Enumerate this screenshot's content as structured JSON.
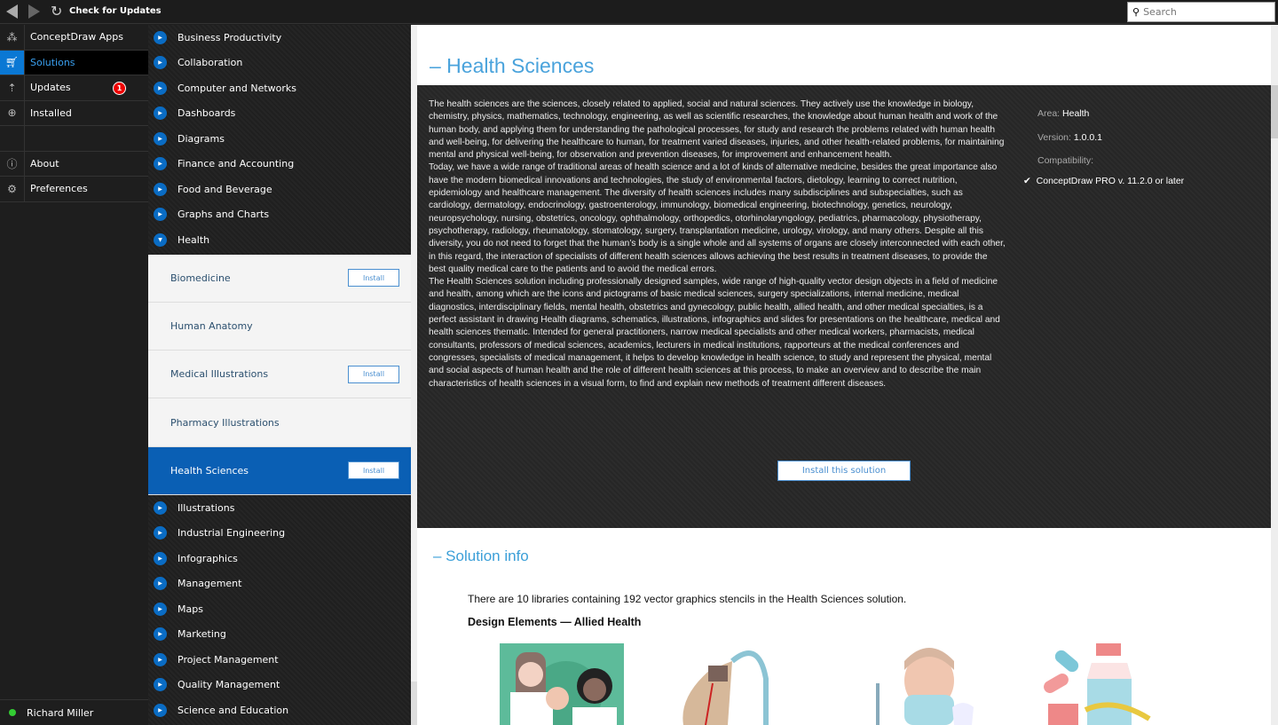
{
  "toolbar": {
    "check_updates": "Check for Updates",
    "search_placeholder": "Search"
  },
  "left_nav": {
    "items": [
      {
        "label": "ConceptDraw Apps",
        "icon": "apps-icon"
      },
      {
        "label": "Solutions",
        "icon": "cart-icon",
        "selected": true
      },
      {
        "label": "Updates",
        "icon": "updates-icon",
        "badge": "1"
      },
      {
        "label": "Installed",
        "icon": "download-icon"
      },
      {
        "label": "",
        "icon": ""
      },
      {
        "label": "About",
        "icon": "info-icon"
      },
      {
        "label": "Preferences",
        "icon": "gear-icon"
      }
    ],
    "user": "Richard Miller"
  },
  "categories_top": [
    "Business Productivity",
    "Collaboration",
    "Computer and Networks",
    "Dashboards",
    "Diagrams",
    "Finance and Accounting",
    "Food and Beverage",
    "Graphs and Charts",
    "Health"
  ],
  "health_solutions": [
    {
      "name": "Biomedicine",
      "button": "Install"
    },
    {
      "name": "Human Anatomy",
      "button": ""
    },
    {
      "name": "Medical Illustrations",
      "button": "Install"
    },
    {
      "name": "Pharmacy Illustrations",
      "button": ""
    },
    {
      "name": "Health Sciences",
      "button": "Install",
      "selected": true
    }
  ],
  "categories_bottom": [
    "Illustrations",
    "Industrial Engineering",
    "Infographics",
    "Management",
    "Maps",
    "Marketing",
    "Project Management",
    "Quality Management",
    "Science and Education"
  ],
  "main": {
    "title": "– Health Sciences",
    "description": [
      "The health sciences are the sciences, closely related to applied, social and natural sciences. They actively use the knowledge in biology, chemistry, physics, mathematics, technology, engineering, as well as scientific researches, the knowledge about human health and work of the human body, and applying them for understanding the pathological processes, for study and research the problems related with human health and well-being, for delivering the healthcare to human, for treatment varied diseases, injuries, and other health-related problems, for maintaining mental and physical well-being, for observation and prevention diseases, for improvement and enhancement health.",
      "Today, we have a wide range of traditional areas of health science and a lot of kinds of alternative medicine, besides the great importance also have the modern biomedical innovations and technologies, the study of environmental factors, dietology, learning to correct nutrition, epidemiology and healthcare management. The diversity of health sciences includes many subdisciplines and subspecialties, such as cardiology, dermatology, endocrinology, gastroenterology, immunology, biomedical engineering, biotechnology, genetics, neurology, neuropsychology, nursing, obstetrics, oncology, ophthalmology, orthopedics, otorhinolaryngology, pediatrics, pharmacology, physiotherapy, psychotherapy, radiology, rheumatology, stomatology, surgery, transplantation medicine, urology, virology, and many others. Despite all this diversity, you do not need to forget that the human’s body is a single whole and all systems of organs are closely interconnected with each other, in this regard, the interaction of specialists of different health sciences allows achieving the best results in treatment diseases, to provide the best quality medical care to the patients and to avoid the medical errors.",
      "The Health Sciences solution including professionally designed samples, wide range of high-quality vector design objects in a field of medicine and health, among which are the icons and pictograms of basic medical sciences, surgery specializations, internal medicine, medical diagnostics, interdisciplinary fields, mental health, obstetrics and gynecology, public health, allied health, and other medical specialties, is a perfect assistant in drawing Health diagrams, schematics, illustrations, infographics and slides for presentations on the healthcare, medical and health sciences thematic. Intended for general practitioners, narrow medical specialists and other medical workers, pharmacists, medical consultants, professors of medical sciences, academics, lecturers in medical institutions, rapporteurs at the medical conferences and congresses, specialists of medical management, it helps to develop knowledge in health science, to study and represent the physical, mental and social aspects of human health and the role of different health sciences at this process, to make an overview and to describe the main characteristics of health sciences in a visual form, to find and explain new methods of treatment different diseases."
    ],
    "area_label": "Area:",
    "area": "Health",
    "version_label": "Version:",
    "version": "1.0.0.1",
    "compat_label": "Compatibility:",
    "compat": "ConceptDraw PRO v. 11.2.0 or later",
    "install_button": "Install this solution",
    "solution_info_title": "– Solution info",
    "solution_info_text": "There are 10 libraries containing 192 vector graphics stencils in the Health Sciences solution.",
    "design_elements_title": "Design Elements — Allied Health"
  },
  "colors": {
    "accent": "#0a78d4",
    "selected_solution": "#0a5fb4",
    "title": "#4aa3dc",
    "badge": "#e00000",
    "online": "#33cc33"
  }
}
